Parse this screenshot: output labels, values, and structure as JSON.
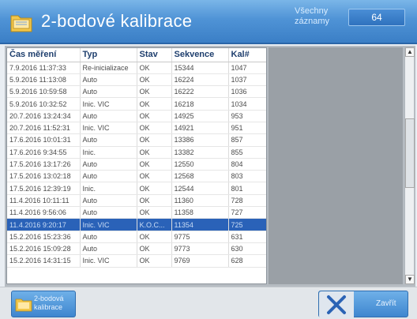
{
  "header": {
    "title": "2-bodové kalibrace",
    "records_label": "Všechny záznamy",
    "records_count": "64"
  },
  "table": {
    "columns": [
      "Čas měření",
      "Typ",
      "Stav",
      "Sekvence",
      "Kal#"
    ],
    "rows": [
      [
        "7.9.2016 11:37:33",
        "Re-inicializace",
        "OK",
        "15344",
        "1047"
      ],
      [
        "5.9.2016 11:13:08",
        "Auto",
        "OK",
        "16224",
        "1037"
      ],
      [
        "5.9.2016 10:59:58",
        "Auto",
        "OK",
        "16222",
        "1036"
      ],
      [
        "5.9.2016 10:32:52",
        "Inic. VIC",
        "OK",
        "16218",
        "1034"
      ],
      [
        "20.7.2016 13:24:34",
        "Auto",
        "OK",
        "14925",
        "953"
      ],
      [
        "20.7.2016 11:52:31",
        "Inic. VIC",
        "OK",
        "14921",
        "951"
      ],
      [
        "17.6.2016 10:01:31",
        "Auto",
        "OK",
        "13386",
        "857"
      ],
      [
        "17.6.2016 9:34:55",
        "Inic.",
        "OK",
        "13382",
        "855"
      ],
      [
        "17.5.2016 13:17:26",
        "Auto",
        "OK",
        "12550",
        "804"
      ],
      [
        "17.5.2016 13:02:18",
        "Auto",
        "OK",
        "12568",
        "803"
      ],
      [
        "17.5.2016 12:39:19",
        "Inic.",
        "OK",
        "12544",
        "801"
      ],
      [
        "11.4.2016 10:11:11",
        "Auto",
        "OK",
        "11360",
        "728"
      ],
      [
        "11.4.2016 9:56:06",
        "Auto",
        "OK",
        "11358",
        "727"
      ],
      [
        "11.4.2016 9:20:17",
        "Inic. VIC",
        "K.O.C...",
        "11354",
        "725"
      ],
      [
        "15.2.2016 15:23:36",
        "Auto",
        "OK",
        "9775",
        "631"
      ],
      [
        "15.2.2016 15:09:28",
        "Auto",
        "OK",
        "9773",
        "630"
      ],
      [
        "15.2.2016 14:31:15",
        "Inic. VIC",
        "OK",
        "9769",
        "628"
      ]
    ],
    "selected_row": 13
  },
  "footer": {
    "calib_button_label": "2-bodová kalibrace",
    "close_button_label": "Zavřít"
  },
  "colors": {
    "header_blue": "#3b7fc6",
    "selection_blue": "#2a62b8",
    "panel_gray": "#9aa0a6"
  },
  "icons": {
    "title": "folder-icon",
    "calib": "folder-icon",
    "close": "close-x-icon",
    "scroll_up": "arrow-up-icon",
    "scroll_down": "arrow-down-icon"
  }
}
